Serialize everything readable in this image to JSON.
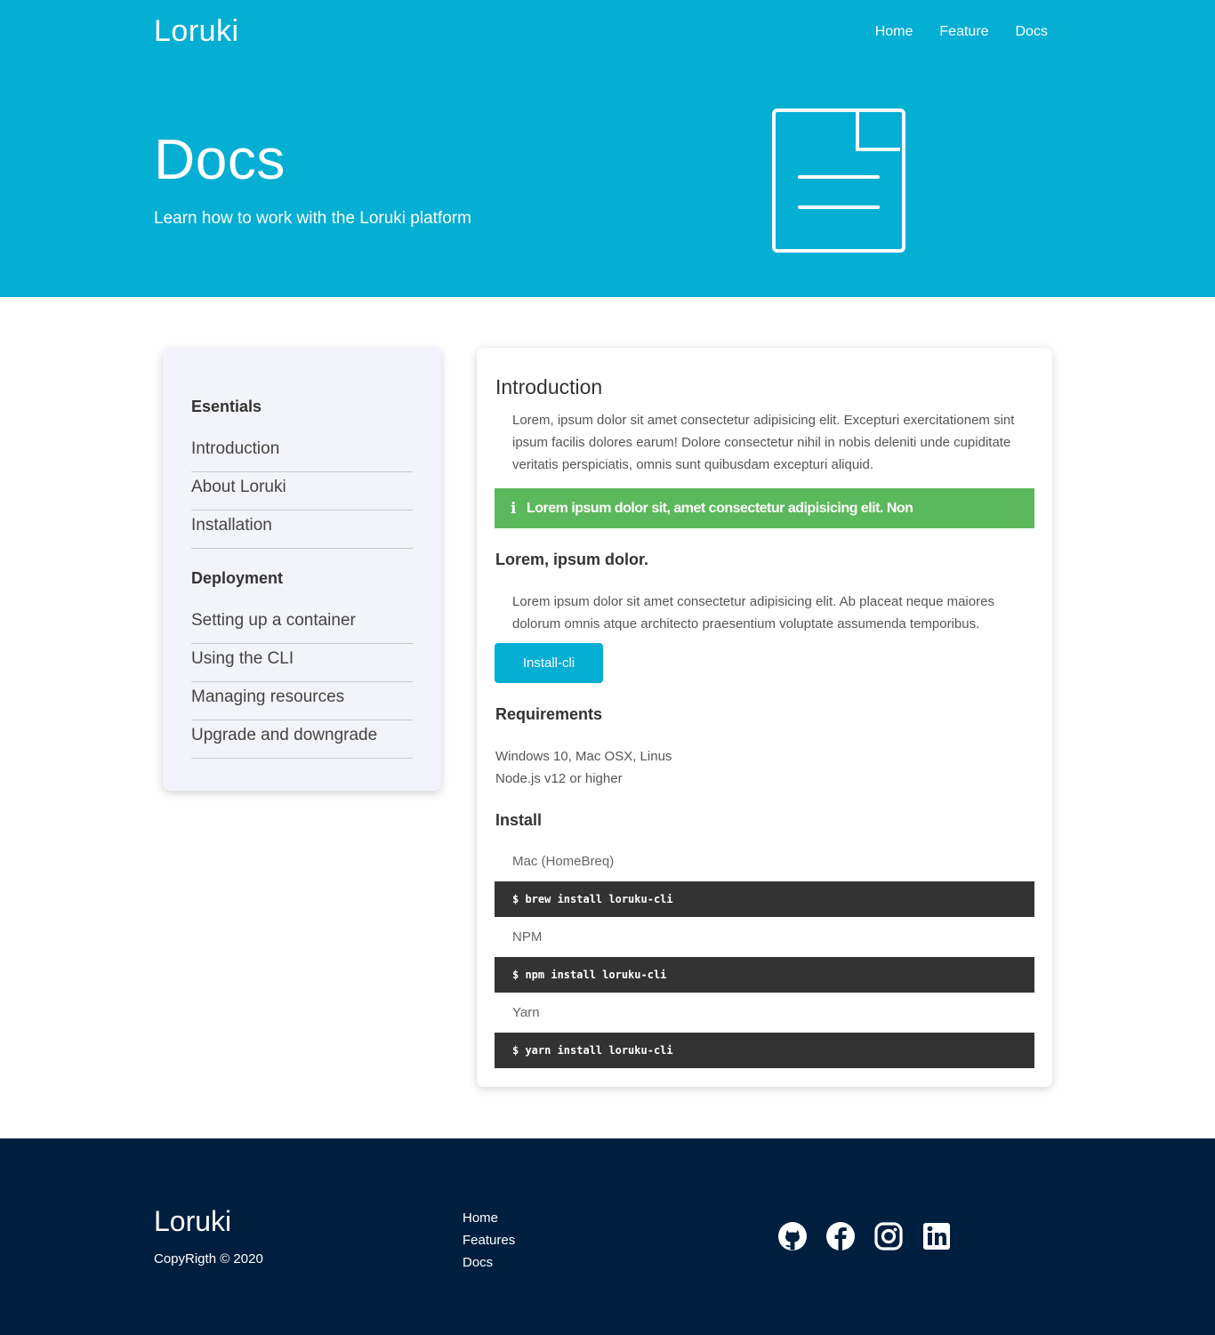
{
  "header": {
    "brand": "Loruki",
    "nav": [
      "Home",
      "Feature",
      "Docs"
    ]
  },
  "hero": {
    "title": "Docs",
    "subtitle": "Learn how to work with the Loruki platform",
    "icon": "document-icon"
  },
  "sidebar": {
    "groups": [
      {
        "title": "Esentials",
        "items": [
          "Introduction",
          "About Loruki",
          "Installation"
        ]
      },
      {
        "title": "Deployment",
        "items": [
          "Setting up a container",
          "Using the CLI",
          "Managing resources",
          "Upgrade and downgrade"
        ]
      }
    ]
  },
  "content": {
    "title": "Introduction",
    "intro": "Lorem, ipsum dolor sit amet consectetur adipisicing elit. Excepturi exercitationem sint ipsum facilis dolores earum! Dolore consectetur nihil in nobis deleniti unde cupiditate veritatis perspiciatis, omnis sunt quibusdam excepturi aliquid.",
    "alert": {
      "icon": "info-icon",
      "text": "Lorem ipsum dolor sit, amet consectetur adipisicing elit. Non"
    },
    "section_heading": "Lorem, ipsum dolor.",
    "section_text": "Lorem ipsum dolor sit amet consectetur adipisicing elit. Ab placeat neque maiores dolorum omnis atque architecto praesentium voluptate assumenda temporibus.",
    "button": "Install-cli",
    "requirements_heading": "Requirements",
    "requirements": [
      "Windows 10, Mac OSX, Linus",
      "Node.js v12 or higher"
    ],
    "install_heading": "Install",
    "install": [
      {
        "label": "Mac (HomeBreq)",
        "command": "$ brew install loruku-cli"
      },
      {
        "label": "NPM",
        "command": "$ npm install loruku-cli"
      },
      {
        "label": "Yarn",
        "command": "$ yarn install loruku-cli"
      }
    ]
  },
  "footer": {
    "brand": "Loruki",
    "copyright": "CopyRigth © 2020",
    "links": [
      "Home",
      "Features",
      "Docs"
    ],
    "social": [
      "github-icon",
      "facebook-icon",
      "instagram-icon",
      "linkedin-icon"
    ]
  },
  "colors": {
    "primary": "#05aed3",
    "success": "#5cb85c",
    "dark": "#333333",
    "footer": "#001f3f",
    "sidebar_bg": "#f3f3fc"
  }
}
